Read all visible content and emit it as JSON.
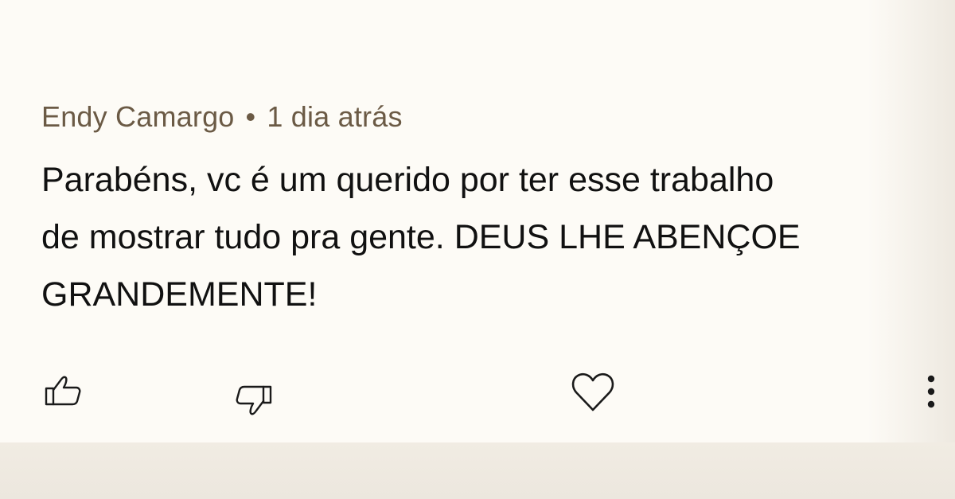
{
  "comment": {
    "author": "Endy Camargo",
    "separator": "•",
    "timestamp": "1 dia atrás",
    "text_lines": [
      "Parabéns, vc é um querido por ter esse trabalho",
      "de mostrar tudo pra gente. DEUS LHE ABENÇOE",
      "GRANDEMENTE!"
    ]
  },
  "actions": {
    "like_icon": "thumbs-up-icon",
    "dislike_icon": "thumbs-down-icon",
    "heart_icon": "heart-icon",
    "more_icon": "more-vertical-icon"
  },
  "colors": {
    "background": "#fdfbf6",
    "meta_text": "#6b5a45",
    "comment_text": "#111111",
    "icon": "#1a1a1a"
  }
}
